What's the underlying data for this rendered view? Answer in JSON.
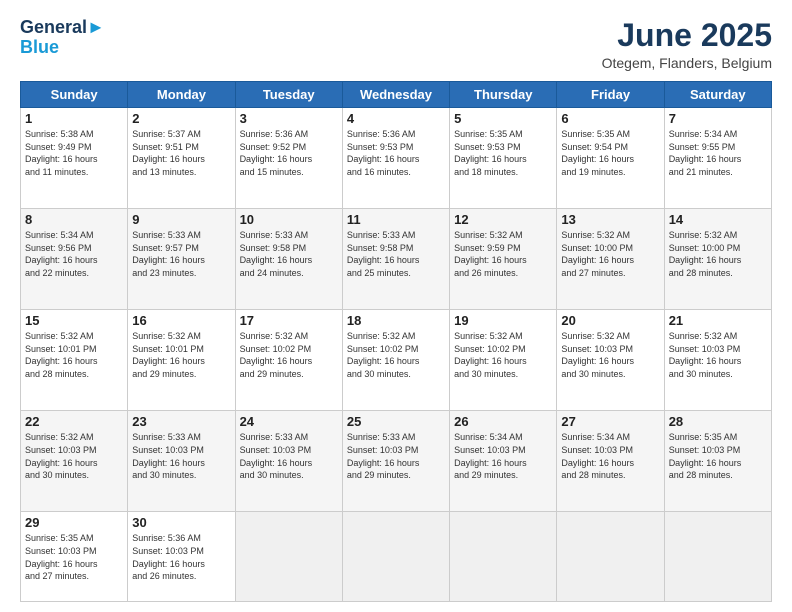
{
  "header": {
    "logo_line1": "General",
    "logo_line2": "Blue",
    "month": "June 2025",
    "location": "Otegem, Flanders, Belgium"
  },
  "weekdays": [
    "Sunday",
    "Monday",
    "Tuesday",
    "Wednesday",
    "Thursday",
    "Friday",
    "Saturday"
  ],
  "weeks": [
    [
      {
        "day": "1",
        "info": "Sunrise: 5:38 AM\nSunset: 9:49 PM\nDaylight: 16 hours\nand 11 minutes."
      },
      {
        "day": "2",
        "info": "Sunrise: 5:37 AM\nSunset: 9:51 PM\nDaylight: 16 hours\nand 13 minutes."
      },
      {
        "day": "3",
        "info": "Sunrise: 5:36 AM\nSunset: 9:52 PM\nDaylight: 16 hours\nand 15 minutes."
      },
      {
        "day": "4",
        "info": "Sunrise: 5:36 AM\nSunset: 9:53 PM\nDaylight: 16 hours\nand 16 minutes."
      },
      {
        "day": "5",
        "info": "Sunrise: 5:35 AM\nSunset: 9:53 PM\nDaylight: 16 hours\nand 18 minutes."
      },
      {
        "day": "6",
        "info": "Sunrise: 5:35 AM\nSunset: 9:54 PM\nDaylight: 16 hours\nand 19 minutes."
      },
      {
        "day": "7",
        "info": "Sunrise: 5:34 AM\nSunset: 9:55 PM\nDaylight: 16 hours\nand 21 minutes."
      }
    ],
    [
      {
        "day": "8",
        "info": "Sunrise: 5:34 AM\nSunset: 9:56 PM\nDaylight: 16 hours\nand 22 minutes."
      },
      {
        "day": "9",
        "info": "Sunrise: 5:33 AM\nSunset: 9:57 PM\nDaylight: 16 hours\nand 23 minutes."
      },
      {
        "day": "10",
        "info": "Sunrise: 5:33 AM\nSunset: 9:58 PM\nDaylight: 16 hours\nand 24 minutes."
      },
      {
        "day": "11",
        "info": "Sunrise: 5:33 AM\nSunset: 9:58 PM\nDaylight: 16 hours\nand 25 minutes."
      },
      {
        "day": "12",
        "info": "Sunrise: 5:32 AM\nSunset: 9:59 PM\nDaylight: 16 hours\nand 26 minutes."
      },
      {
        "day": "13",
        "info": "Sunrise: 5:32 AM\nSunset: 10:00 PM\nDaylight: 16 hours\nand 27 minutes."
      },
      {
        "day": "14",
        "info": "Sunrise: 5:32 AM\nSunset: 10:00 PM\nDaylight: 16 hours\nand 28 minutes."
      }
    ],
    [
      {
        "day": "15",
        "info": "Sunrise: 5:32 AM\nSunset: 10:01 PM\nDaylight: 16 hours\nand 28 minutes."
      },
      {
        "day": "16",
        "info": "Sunrise: 5:32 AM\nSunset: 10:01 PM\nDaylight: 16 hours\nand 29 minutes."
      },
      {
        "day": "17",
        "info": "Sunrise: 5:32 AM\nSunset: 10:02 PM\nDaylight: 16 hours\nand 29 minutes."
      },
      {
        "day": "18",
        "info": "Sunrise: 5:32 AM\nSunset: 10:02 PM\nDaylight: 16 hours\nand 30 minutes."
      },
      {
        "day": "19",
        "info": "Sunrise: 5:32 AM\nSunset: 10:02 PM\nDaylight: 16 hours\nand 30 minutes."
      },
      {
        "day": "20",
        "info": "Sunrise: 5:32 AM\nSunset: 10:03 PM\nDaylight: 16 hours\nand 30 minutes."
      },
      {
        "day": "21",
        "info": "Sunrise: 5:32 AM\nSunset: 10:03 PM\nDaylight: 16 hours\nand 30 minutes."
      }
    ],
    [
      {
        "day": "22",
        "info": "Sunrise: 5:32 AM\nSunset: 10:03 PM\nDaylight: 16 hours\nand 30 minutes."
      },
      {
        "day": "23",
        "info": "Sunrise: 5:33 AM\nSunset: 10:03 PM\nDaylight: 16 hours\nand 30 minutes."
      },
      {
        "day": "24",
        "info": "Sunrise: 5:33 AM\nSunset: 10:03 PM\nDaylight: 16 hours\nand 30 minutes."
      },
      {
        "day": "25",
        "info": "Sunrise: 5:33 AM\nSunset: 10:03 PM\nDaylight: 16 hours\nand 29 minutes."
      },
      {
        "day": "26",
        "info": "Sunrise: 5:34 AM\nSunset: 10:03 PM\nDaylight: 16 hours\nand 29 minutes."
      },
      {
        "day": "27",
        "info": "Sunrise: 5:34 AM\nSunset: 10:03 PM\nDaylight: 16 hours\nand 28 minutes."
      },
      {
        "day": "28",
        "info": "Sunrise: 5:35 AM\nSunset: 10:03 PM\nDaylight: 16 hours\nand 28 minutes."
      }
    ],
    [
      {
        "day": "29",
        "info": "Sunrise: 5:35 AM\nSunset: 10:03 PM\nDaylight: 16 hours\nand 27 minutes."
      },
      {
        "day": "30",
        "info": "Sunrise: 5:36 AM\nSunset: 10:03 PM\nDaylight: 16 hours\nand 26 minutes."
      },
      {
        "day": "",
        "info": ""
      },
      {
        "day": "",
        "info": ""
      },
      {
        "day": "",
        "info": ""
      },
      {
        "day": "",
        "info": ""
      },
      {
        "day": "",
        "info": ""
      }
    ]
  ]
}
